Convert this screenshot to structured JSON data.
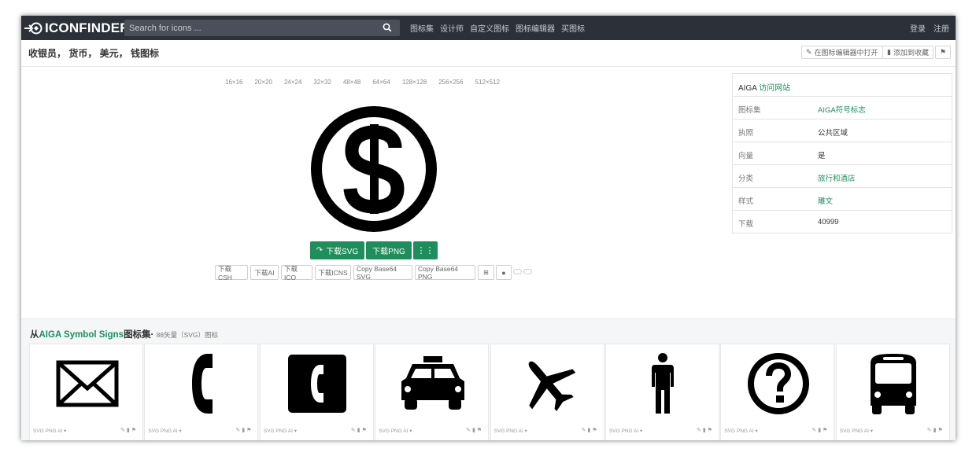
{
  "header": {
    "logo_text": "ICONFINDER",
    "search_placeholder": "Search for icons ...",
    "nav": [
      "图标集",
      "设计师",
      "自定义图标",
      "图标编辑器",
      "买图标"
    ],
    "login": "登录",
    "register": "注册"
  },
  "page": {
    "title": "收银员， 货币， 美元， 钱图标",
    "open_editor": "在图标编辑器中打开",
    "add_fav": "添加到收藏"
  },
  "sizes": [
    "16×16",
    "20×20",
    "24×24",
    "32×32",
    "48×48",
    "64×64",
    "128×128",
    "256×256",
    "512×512"
  ],
  "downloads": {
    "svg": "下载SVG",
    "png": "下载PNG",
    "csh": "下载CSH",
    "ai": "下载AI",
    "ico": "下载ICO",
    "icns": "下载ICNS",
    "b64svg": "Copy Base64 SVG",
    "b64png": "Copy Base64 PNG"
  },
  "info": {
    "author": "AIGA",
    "visit": "访问网站",
    "rows": [
      {
        "k": "图标集",
        "v": "AIGA符号标志"
      },
      {
        "k": "执照",
        "v": "公共区域"
      },
      {
        "k": "向量",
        "v": "是"
      },
      {
        "k": "分类",
        "v": "旅行和酒店"
      },
      {
        "k": "样式",
        "v": "雕文"
      },
      {
        "k": "下载",
        "v": "40999"
      }
    ]
  },
  "iconset": {
    "prefix": "从",
    "name": "AIGA Symbol Signs",
    "suffix": "图标集·",
    "count": "88矢量（SVG）图标",
    "card_meta": "SVG  PNG  AI  ▾",
    "card_icons": [
      "envelope-icon",
      "phone-handset-icon",
      "phone-booth-icon",
      "taxi-icon",
      "airplane-icon",
      "man-icon",
      "question-icon",
      "bus-icon"
    ]
  },
  "colors": {
    "accent": "#1f8e5c",
    "topbar": "#2c3039"
  }
}
